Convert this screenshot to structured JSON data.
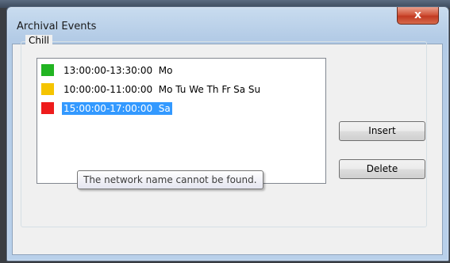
{
  "window": {
    "title": "Archival Events",
    "close_label": "x"
  },
  "group": {
    "label": "Chill"
  },
  "events": [
    {
      "time": "13:00:00-13:30:00",
      "days": "Mo",
      "color": "#22b422",
      "selected": false
    },
    {
      "time": "10:00:00-11:00:00",
      "days": "Mo Tu We Th Fr Sa Su",
      "color": "#f5c400",
      "selected": false
    },
    {
      "time": "15:00:00-17:00:00",
      "days": "Sa",
      "color": "#ee1c1c",
      "selected": true
    }
  ],
  "tooltip": {
    "text": "The network name cannot be found."
  },
  "buttons": {
    "insert_label": "Insert",
    "delete_label": "Delete"
  }
}
